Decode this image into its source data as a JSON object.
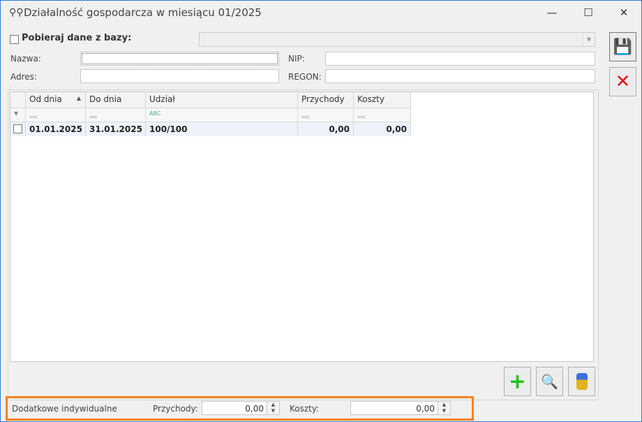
{
  "window": {
    "title": "Działalność gospodarcza w miesiącu 01/2025",
    "minimize": "—",
    "maximize": "☐",
    "close": "✕"
  },
  "form": {
    "fetch_label": "Pobieraj dane z bazy:",
    "fetch_checked": false,
    "nazwa_label": "Nazwa:",
    "nazwa_value": "",
    "nip_label": "NIP:",
    "nip_value": "",
    "adres_label": "Adres:",
    "adres_value": "",
    "regon_label": "REGON:",
    "regon_value": ""
  },
  "grid": {
    "columns": [
      "Od dnia",
      "Do dnia",
      "Udział",
      "Przychody",
      "Koszty"
    ],
    "rows": [
      {
        "od": "01.01.2025",
        "do": "31.01.2025",
        "udzial": "100/100",
        "przychody": "0,00",
        "koszty": "0,00"
      }
    ]
  },
  "bottom": {
    "label": "Dodatkowe indywidualne",
    "przychody_label": "Przychody:",
    "przychody_value": "0,00",
    "koszty_label": "Koszty:",
    "koszty_value": "0,00"
  },
  "colors": {
    "highlight": "#f5821f",
    "window_border": "#2b79d0"
  }
}
